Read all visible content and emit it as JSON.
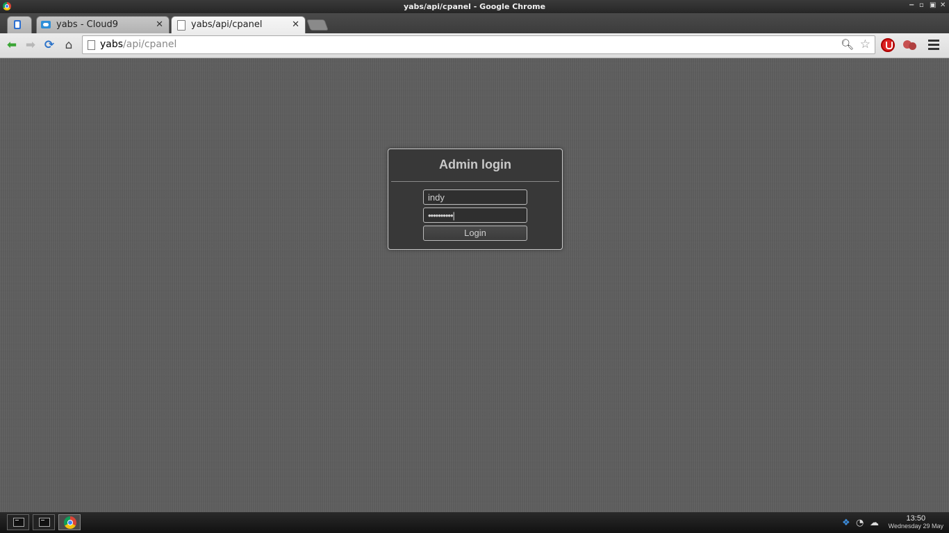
{
  "window": {
    "title": "yabs/api/cpanel - Google Chrome",
    "controls": [
      "−",
      "▫",
      "▣",
      "✕"
    ]
  },
  "tabs": [
    {
      "label": "",
      "pinned": true,
      "active": false
    },
    {
      "label": "yabs - Cloud9",
      "active": false,
      "close": "✕"
    },
    {
      "label": "yabs/api/cpanel",
      "active": true,
      "close": "✕"
    }
  ],
  "toolbar": {
    "url_host": "yabs",
    "url_path": "/api/cpanel"
  },
  "login": {
    "heading": "Admin login",
    "username_value": "indy",
    "password_value": "••••••••••|",
    "button_label": "Login"
  },
  "taskbar": {
    "items": [
      "terminal-1",
      "terminal-2",
      "chrome"
    ],
    "clock_time": "13:50",
    "clock_date": "Wednesday 29 May"
  },
  "colors": {
    "background": "#5e5e5e",
    "card": "#383838",
    "card_border": "#c9c9c9",
    "heading_text": "#c9c9c9",
    "back_arrow": "#3aa535"
  }
}
